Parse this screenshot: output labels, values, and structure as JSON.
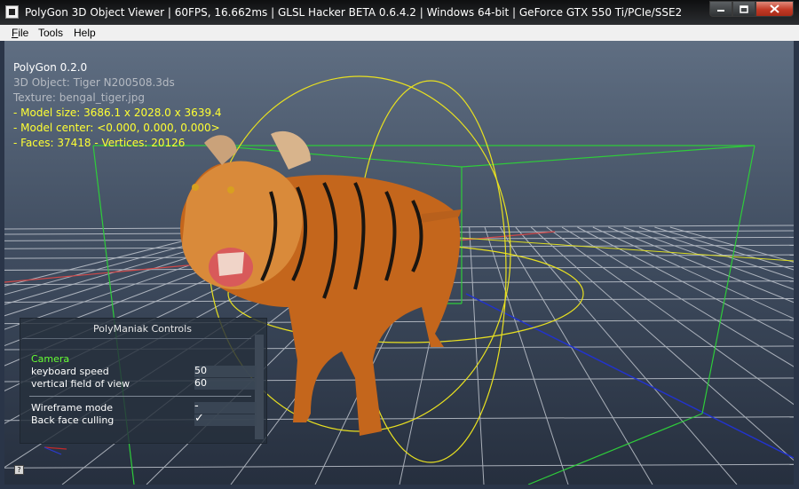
{
  "window": {
    "title": "PolyGon 3D Object Viewer | 60FPS, 16.662ms | GLSL Hacker BETA 0.6.4.2 | Windows 64-bit | GeForce GTX 550 Ti/PCIe/SSE2",
    "app_icon": "app-icon",
    "minimize_icon": "minimize-icon",
    "maximize_icon": "maximize-icon",
    "close_icon": "close-icon"
  },
  "menu": {
    "items": [
      {
        "label": "File",
        "accel": "F",
        "rest": "ile"
      },
      {
        "label": "Tools"
      },
      {
        "label": "Help"
      }
    ]
  },
  "hud": {
    "title": "PolyGon 0.2.0",
    "object": "3D Object: Tiger N200508.3ds",
    "texture": "Texture: bengal_tiger.jpg",
    "model_size": "- Model size:  3686.1 x 2028.0 x 3639.4",
    "model_center": "- Model center:  <0.000, 0.000, 0.000>",
    "faces": "- Faces: 37418 - Vertices: 20126"
  },
  "controls": {
    "title": "PolyManiak Controls",
    "camera_label": "Camera",
    "keyboard_speed": {
      "label": "keyboard speed",
      "value": "50"
    },
    "vertical_fov": {
      "label": "vertical field of view",
      "value": "60"
    },
    "wireframe_mode": {
      "label": "Wireframe mode",
      "value": "-"
    },
    "back_face_culling": {
      "label": "Back face culling",
      "checked": true,
      "mark": "✓"
    }
  },
  "colors": {
    "hud_yellow": "#ffff33",
    "camera_green": "#66ff33",
    "bbox_green": "#2ecc3a",
    "sphere_yellow": "#e8e020",
    "tiger_orange": "#c4661c"
  }
}
